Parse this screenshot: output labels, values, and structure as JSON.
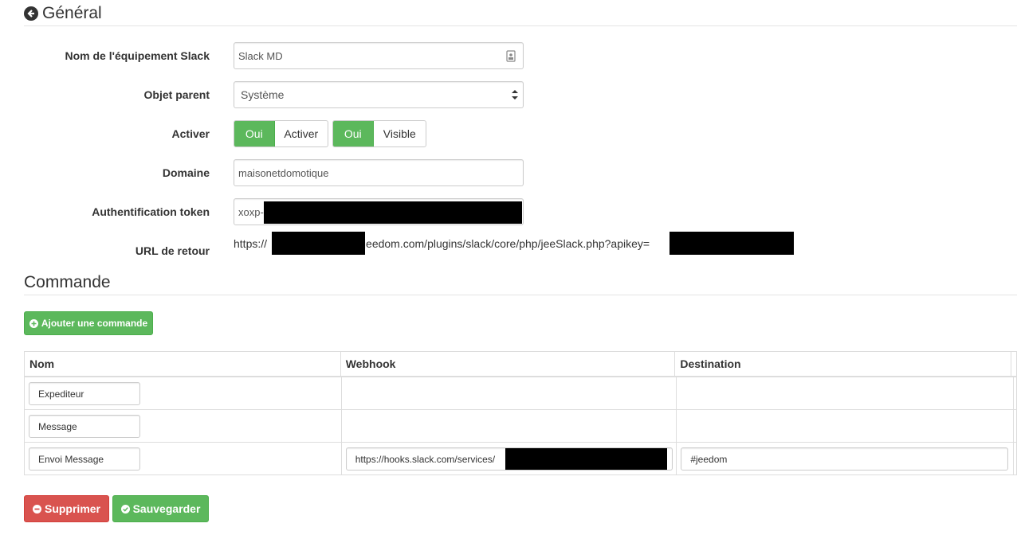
{
  "general": {
    "title": "Général",
    "equipment_name": {
      "label": "Nom de l'équipement Slack",
      "value": "Slack MD"
    },
    "parent_object": {
      "label": "Objet parent",
      "value": "Système"
    },
    "activate": {
      "label": "Activer",
      "toggle1_on": "Oui",
      "toggle1_text": "Activer",
      "toggle2_on": "Oui",
      "toggle2_text": "Visible"
    },
    "domain": {
      "label": "Domaine",
      "value": "maisonetdomotique"
    },
    "auth_token": {
      "label": "Authentification token",
      "value_prefix": "xoxp-"
    },
    "return_url": {
      "label": "URL de retour",
      "prefix": "https://",
      "middle": ".jeedom.com/plugins/slack/core/php/jeeSlack.php?apikey="
    }
  },
  "commands": {
    "title": "Commande",
    "add_button": "Ajouter une commande",
    "table": {
      "headers": [
        "Nom",
        "Webhook",
        "Destination"
      ],
      "rows": [
        {
          "name": "Expediteur",
          "webhook": "",
          "destination": ""
        },
        {
          "name": "Message",
          "webhook": "",
          "destination": ""
        },
        {
          "name": "Envoi Message",
          "webhook": "https://hooks.slack.com/services/",
          "destination": "#jeedom"
        }
      ]
    }
  },
  "actions": {
    "delete": "Supprimer",
    "save": "Sauvegarder"
  },
  "colors": {
    "success": "#5cb85c",
    "danger": "#d9534f",
    "text": "#333333",
    "border": "#dddddd"
  }
}
